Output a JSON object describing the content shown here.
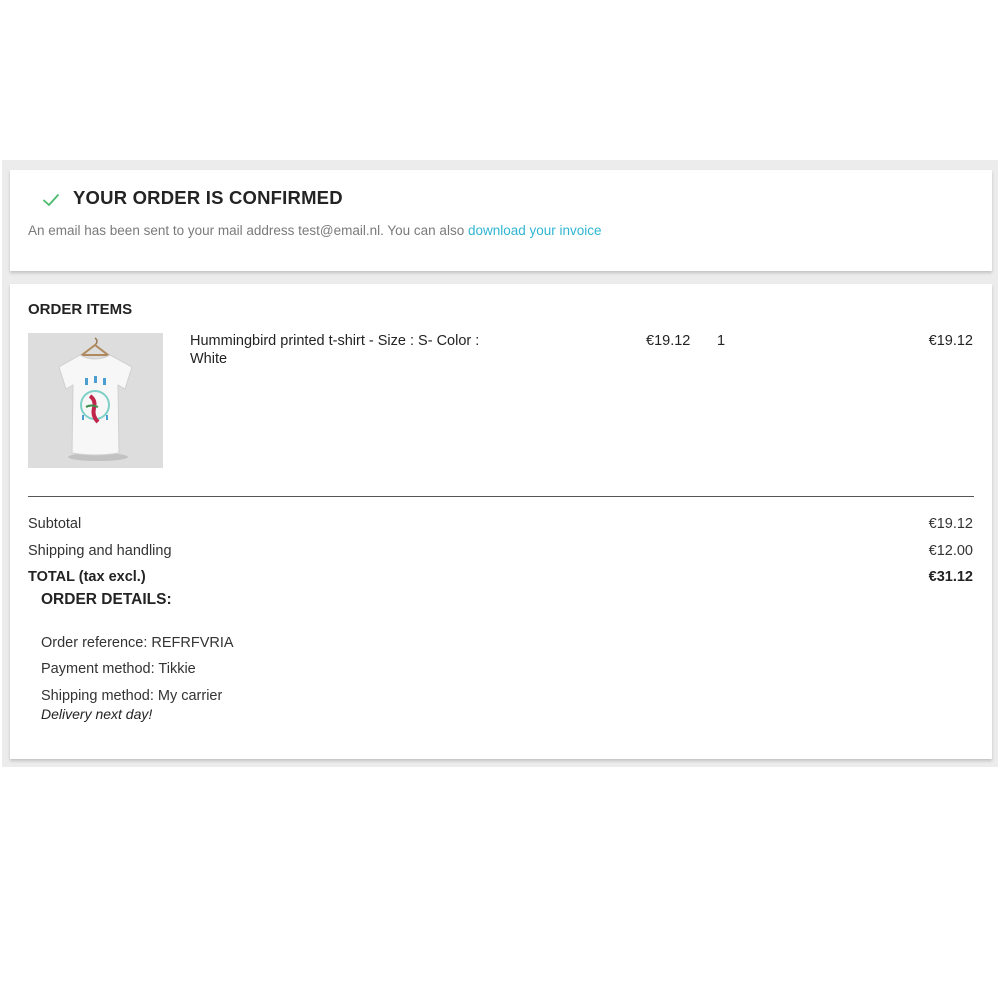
{
  "confirmation": {
    "title": "YOUR ORDER IS CONFIRMED",
    "message": "An email has been sent to your mail address test@email.nl. You can also ",
    "invoice_link": "download your invoice",
    "check_icon": "check-icon",
    "link_color": "#2fb5d2",
    "check_color": "#4cbb6c"
  },
  "order_items": {
    "title": "ORDER ITEMS",
    "items": [
      {
        "name": "Hummingbird printed t-shirt - Size : S- Color : White",
        "unit_price": "€19.12",
        "quantity": "1",
        "total": "€19.12"
      }
    ]
  },
  "totals": {
    "subtotal_label": "Subtotal",
    "subtotal_value": "€19.12",
    "shipping_label": "Shipping and handling",
    "shipping_value": "€12.00",
    "total_label": "TOTAL (tax excl.)",
    "total_value": "€31.12"
  },
  "order_details": {
    "title": "ORDER DETAILS:",
    "reference": "Order reference: REFRFVRIA",
    "payment": "Payment method: Tikkie",
    "shipping": "Shipping method: My carrier",
    "shipping_note": "Delivery next day!"
  }
}
